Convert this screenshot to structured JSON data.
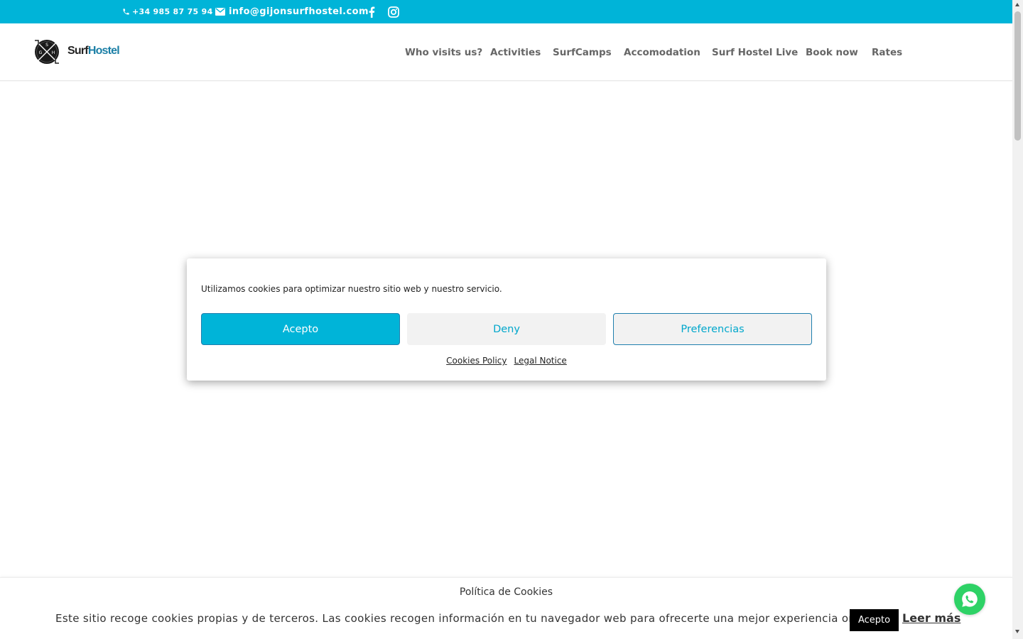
{
  "topbar": {
    "phone": "+34 985 87 75 94",
    "email": "info@gijonsurfhostel.com",
    "background": "#00b4d8",
    "icons": [
      "phone-icon",
      "mail-icon",
      "facebook-icon",
      "instagram-icon"
    ]
  },
  "header": {
    "logo": {
      "monogram": "GSH",
      "small_text": "Gijón",
      "word_surf": "Surf",
      "word_hostel": "Hostel"
    },
    "nav": [
      {
        "label": "Who visits us?"
      },
      {
        "label": "Activities"
      },
      {
        "label": "SurfCamps"
      },
      {
        "label": "Accomodation"
      },
      {
        "label": "Surf Hostel Live"
      },
      {
        "label": "Book now"
      },
      {
        "label": "Rates"
      }
    ]
  },
  "cookie_modal": {
    "message": "Utilizamos cookies para optimizar nuestro sitio web y nuestro servicio.",
    "accept_label": "Acepto",
    "deny_label": "Deny",
    "preferences_label": "Preferencias",
    "links": [
      "Cookies Policy",
      "Legal Notice"
    ],
    "accent_color": "#00b4d8"
  },
  "cookie_bar": {
    "title": "Política de Cookies",
    "text": "Este sitio recoge cookies propias y de terceros. Las cookies recogen información en tu navegador web para ofrecerte una mejor experiencia online.",
    "accept_label": "Acepto",
    "more_label": "Leer más"
  },
  "whatsapp": {
    "icon": "whatsapp-icon",
    "color": "#2ed266"
  }
}
